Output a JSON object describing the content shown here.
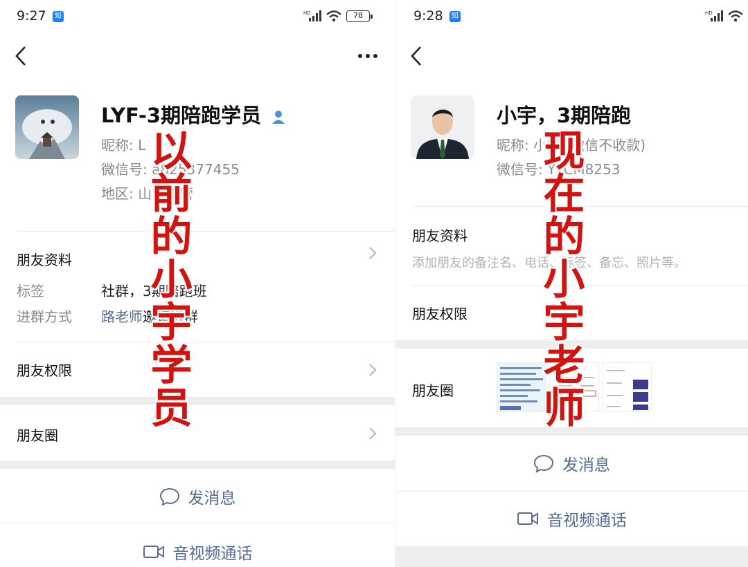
{
  "left": {
    "status": {
      "time": "9:27",
      "badge": "知",
      "battery": "78"
    },
    "contact": {
      "name": "LYF-3期陪跑学员",
      "nickname_label": "昵称:",
      "nickname_value": "L",
      "wechat_label": "微信号:",
      "wechat_value": "a825377455",
      "region_label": "地区:",
      "region_value": "山东东营"
    },
    "sections": {
      "profile": "朋友资料",
      "tag_label": "标签",
      "tag_value": "社群，3期陪跑班",
      "join_label": "进群方式",
      "join_link": "路老师",
      "join_value": "邀请进群",
      "permission": "朋友权限",
      "moments": "朋友圈"
    },
    "actions": {
      "message": "发消息",
      "call": "音视频通话"
    },
    "overlay": "以前的小宇学员"
  },
  "right": {
    "status": {
      "time": "9:28",
      "badge": "知"
    },
    "contact": {
      "name": "小宇，3期陪跑",
      "nickname_label": "昵称:",
      "nickname_value": "小宇 (微信不收款)",
      "wechat_label": "微信号:",
      "wechat_value": "YYCM8253"
    },
    "sections": {
      "profile": "朋友资料",
      "profile_hint": "添加朋友的备注名、电话、标签、备忘、照片等。",
      "permission": "朋友权限",
      "moments": "朋友圈"
    },
    "actions": {
      "message": "发消息",
      "call": "音视频通话"
    },
    "overlay": "现在的小宇老师"
  },
  "colors": {
    "accent": "#576b95",
    "overlay": "#d21410",
    "badge": "#1e80ff"
  }
}
